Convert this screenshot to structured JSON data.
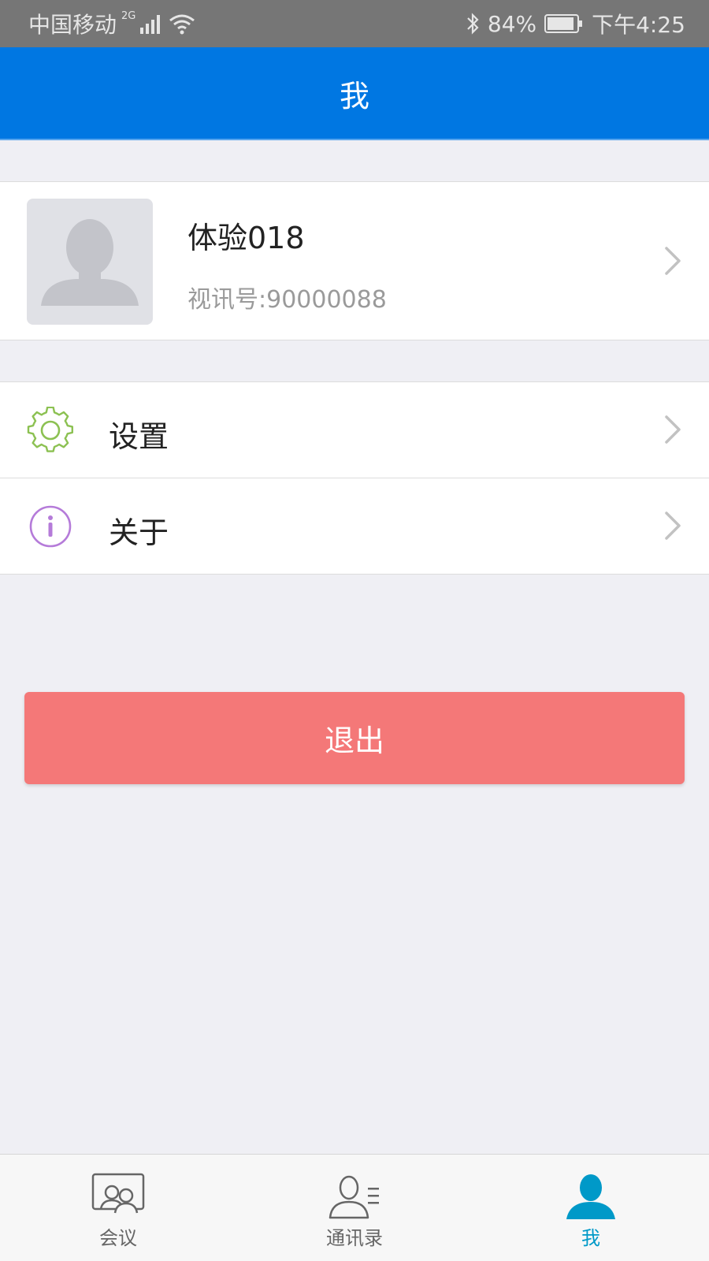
{
  "status_bar": {
    "carrier": "中国移动",
    "network": "2G",
    "battery": "84%",
    "time": "下午4:25"
  },
  "header": {
    "title": "我"
  },
  "profile": {
    "name": "体验018",
    "id_text": "视讯号:90000088"
  },
  "menu": {
    "items": [
      {
        "label": "设置",
        "icon": "gear-icon"
      },
      {
        "label": "关于",
        "icon": "info-icon"
      }
    ]
  },
  "logout": {
    "label": "退出"
  },
  "tabs": [
    {
      "label": "会议",
      "icon": "meeting-icon"
    },
    {
      "label": "通讯录",
      "icon": "contacts-icon"
    },
    {
      "label": "我",
      "icon": "person-icon",
      "active": true
    }
  ],
  "colors": {
    "header_bg": "#0077e2",
    "logout_bg": "#f47878",
    "gear_icon": "#8cc152",
    "info_icon": "#b57bd9",
    "active_tab": "#0099c8"
  }
}
